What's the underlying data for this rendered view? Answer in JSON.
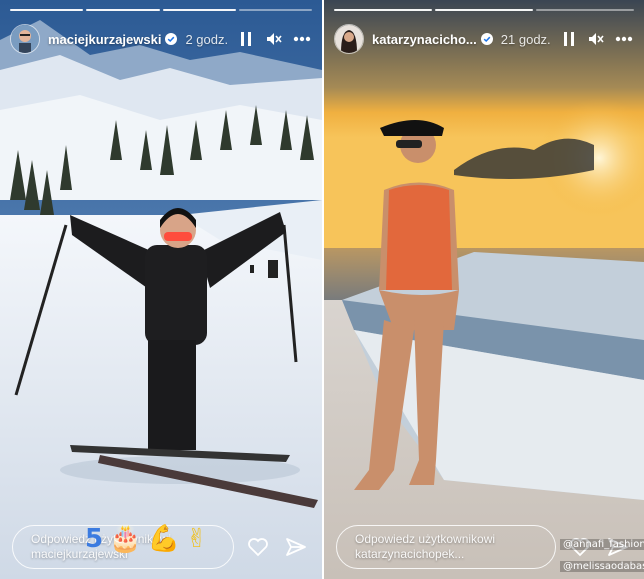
{
  "colors": {
    "sky_left": "#2f5f9a",
    "snow": "#e8eef5",
    "sunset_top": "#3f4a57",
    "sunset_glow": "#f3b63a",
    "swimsuit": "#e2683c",
    "boat": "#c9d4de"
  },
  "stories": [
    {
      "username": "maciejkurzajewski",
      "time": "2 godz.",
      "reply_placeholder": "Odpowiedz użytkownikowi maciejkurzajewski",
      "progress": [
        1,
        1,
        1,
        0.4
      ],
      "stickers": [
        "5",
        "🎂",
        "💪",
        "✌"
      ]
    },
    {
      "username": "katarzynacicho...",
      "time": "21 godz.",
      "reply_placeholder": "Odpowiedz użytkownikowi katarzynacichopek...",
      "progress": [
        1,
        1,
        0.3
      ],
      "tags": [
        "@annafi_fashion",
        "@melissaodabash"
      ]
    }
  ],
  "icons": {
    "verified": "verified-badge-icon",
    "pause": "pause-icon",
    "mute": "mute-icon",
    "more": "more-options-icon",
    "like": "heart-icon",
    "share": "send-icon"
  }
}
